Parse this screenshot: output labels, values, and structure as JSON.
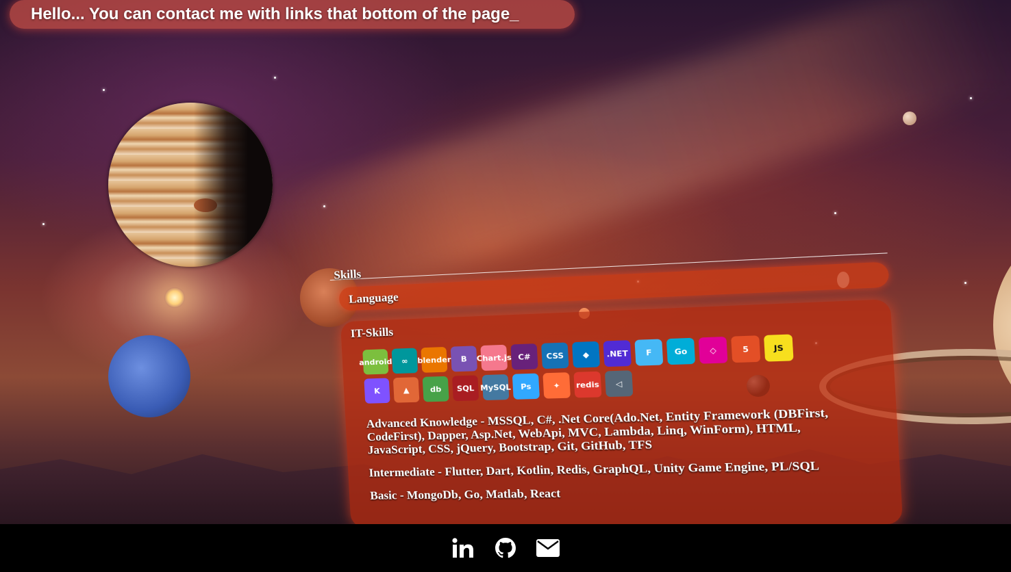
{
  "greeting": {
    "text": "Hello... You can contact me with links that bottom of the page_"
  },
  "panel": {
    "skills_title": "Skills",
    "language_title": "Language",
    "it_skills_title": "IT-Skills",
    "advanced": "Advanced Knowledge - MSSQL, C#, .Net Core(Ado.Net, Entity Framework (DBFirst, CodeFirst), Dapper, Asp.Net, WebApi, MVC, Lambda, Linq, WinForm), HTML, JavaScript, CSS, jQuery, Bootstrap, Git, GitHub, TFS",
    "intermediate": "Intermediate - Flutter, Dart, Kotlin, Redis, GraphQL, Unity Game Engine, PL/SQL",
    "basic": "Basic - MongoDb, Go, Matlab, React"
  },
  "tech_icons": [
    {
      "name": "android-icon",
      "label": "android",
      "color": "#7cbf3e"
    },
    {
      "name": "arduino-icon",
      "label": "∞",
      "color": "#00979c"
    },
    {
      "name": "blender-icon",
      "label": "blender",
      "color": "#ea7600"
    },
    {
      "name": "bootstrap-icon",
      "label": "B",
      "color": "#7952b3"
    },
    {
      "name": "chartjs-icon",
      "label": "Chart.js",
      "color": "#f5788d"
    },
    {
      "name": "csharp-icon",
      "label": "C#",
      "color": "#68217a"
    },
    {
      "name": "css3-icon",
      "label": "CSS",
      "color": "#1572b6"
    },
    {
      "name": "dart-icon",
      "label": "◆",
      "color": "#0175c2"
    },
    {
      "name": "dotnet-icon",
      "label": ".NET",
      "color": "#512bd4"
    },
    {
      "name": "flutter-icon",
      "label": "F",
      "color": "#45b8f5"
    },
    {
      "name": "go-icon",
      "label": "Go",
      "color": "#00add8"
    },
    {
      "name": "graphql-icon",
      "label": "◇",
      "color": "#e10098"
    },
    {
      "name": "html5-icon",
      "label": "5",
      "color": "#e34f26"
    },
    {
      "name": "javascript-icon",
      "label": "JS",
      "color": "#f7df1e"
    },
    {
      "name": "kotlin-icon",
      "label": "K",
      "color": "#7f52ff"
    },
    {
      "name": "matlab-icon",
      "label": "▲",
      "color": "#e16737"
    },
    {
      "name": "mongodb-icon",
      "label": "db",
      "color": "#47a248"
    },
    {
      "name": "mssql-icon",
      "label": "SQL",
      "color": "#a91d22"
    },
    {
      "name": "mysql-icon",
      "label": "MySQL",
      "color": "#4479a1"
    },
    {
      "name": "photoshop-icon",
      "label": "Ps",
      "color": "#31a8ff"
    },
    {
      "name": "postman-icon",
      "label": "✦",
      "color": "#ff6c37"
    },
    {
      "name": "redis-icon",
      "label": "redis",
      "color": "#dc382d"
    },
    {
      "name": "unity-icon",
      "label": "◁",
      "color": "#556677"
    }
  ],
  "footer": {
    "linkedin": "in",
    "github": "github",
    "email": "mail"
  },
  "colors": {
    "accent": "#cd5046",
    "panel": "#be2d0f",
    "footer_bg": "#000000"
  }
}
